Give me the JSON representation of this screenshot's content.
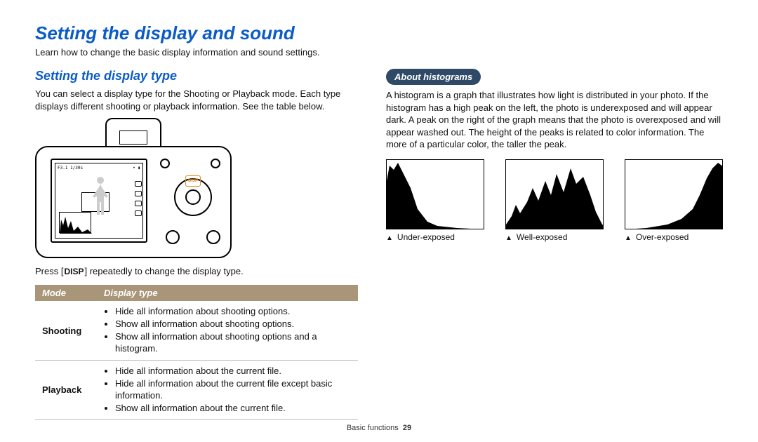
{
  "title": "Setting the display and sound",
  "intro": "Learn how to change the basic display information and sound settings.",
  "left": {
    "heading": "Setting the display type",
    "para": "You can select a display type for the Shooting or Playback mode. Each type displays different shooting or playback information. See the table below.",
    "screen_readout_left": "F3.1  1/30s",
    "screen_readout_right": "•  ▮",
    "disp_label": "DISP",
    "press_line_a": "Press [",
    "press_key": "DISP",
    "press_line_b": "] repeatedly to change the display type.",
    "table": {
      "col_mode": "Mode",
      "col_type": "Display type",
      "rows": [
        {
          "mode": "Shooting",
          "items": [
            "Hide all information about shooting options.",
            "Show all information about shooting options.",
            "Show all information about shooting options and a histogram."
          ]
        },
        {
          "mode": "Playback",
          "items": [
            "Hide all information about the current file.",
            "Hide all information about the current file except basic information.",
            "Show all information about the current file."
          ]
        }
      ]
    }
  },
  "right": {
    "pill": "About histograms",
    "para": "A histogram is a graph that illustrates how light is distributed in your photo. If the histogram has a high peak on the left, the photo is underexposed and will appear dark. A peak on the right of the graph means that the photo is overexposed and will appear washed out. The height of the peaks is related to color information. The more of a particular color, the taller the peak.",
    "hist": {
      "under": "Under-exposed",
      "well": "Well-exposed",
      "over": "Over-exposed"
    }
  },
  "footer": {
    "section": "Basic functions",
    "page": "29"
  }
}
